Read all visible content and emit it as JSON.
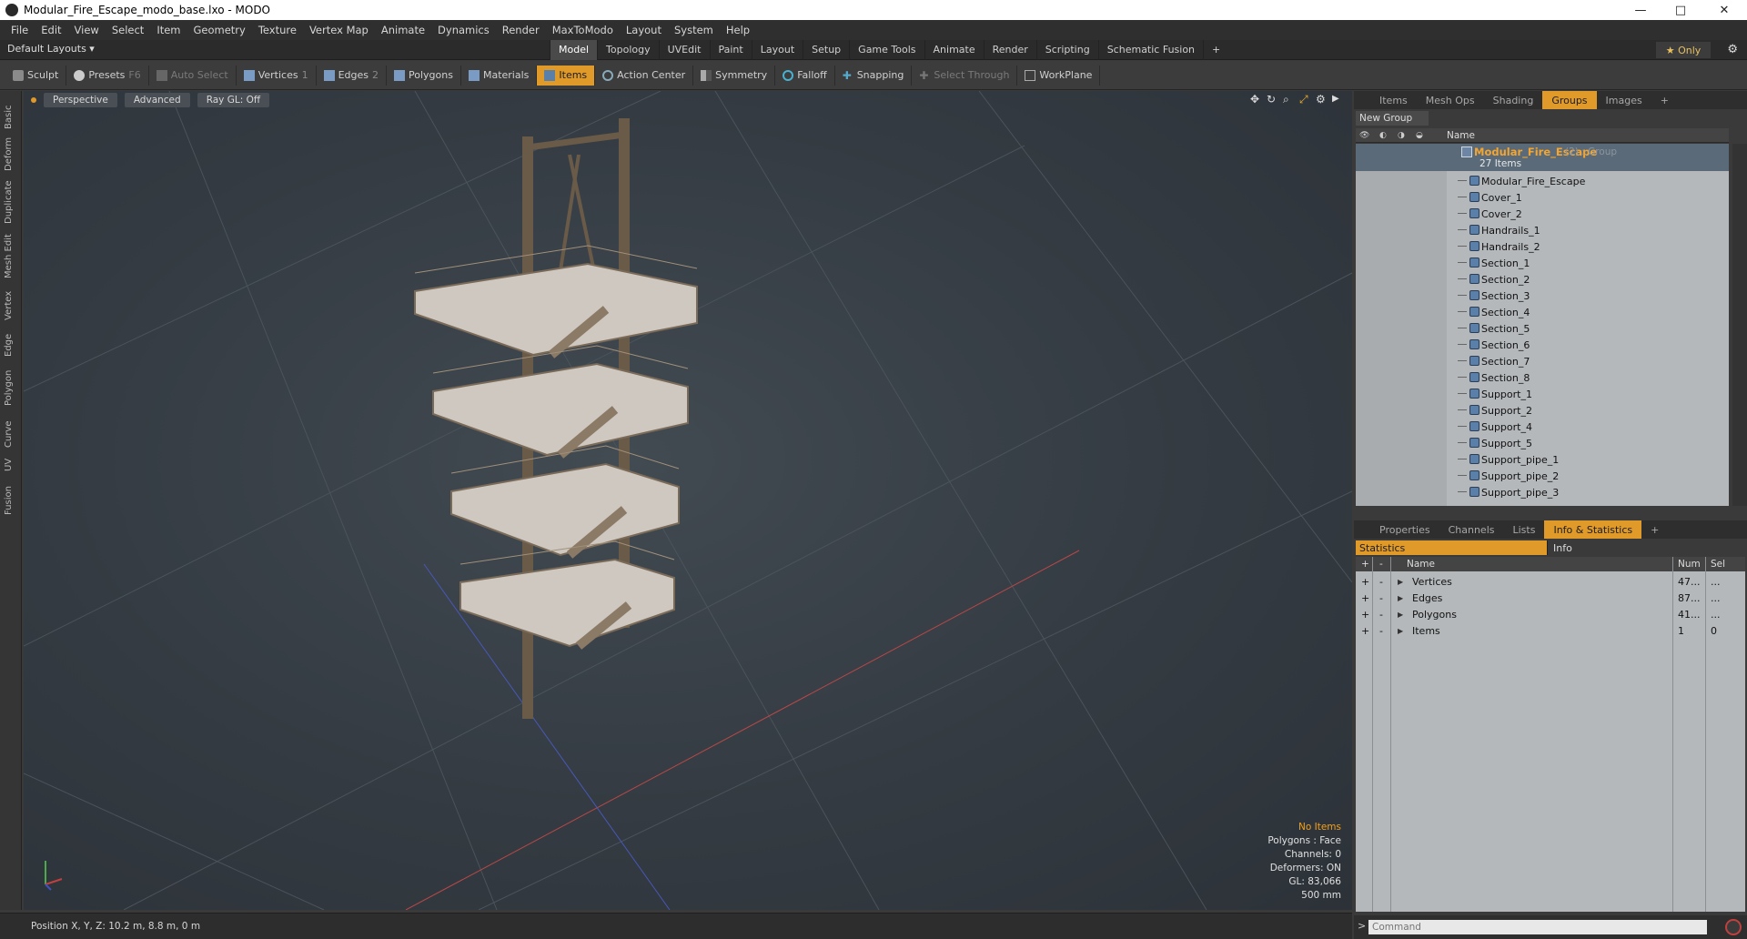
{
  "window": {
    "title": "Modular_Fire_Escape_modo_base.lxo - MODO",
    "minimize": "—",
    "maximize": "□",
    "close": "✕"
  },
  "menu": [
    "File",
    "Edit",
    "View",
    "Select",
    "Item",
    "Geometry",
    "Texture",
    "Vertex Map",
    "Animate",
    "Dynamics",
    "Render",
    "MaxToModo",
    "Layout",
    "System",
    "Help"
  ],
  "layout": {
    "name": "Default Layouts ▾",
    "tabs": [
      "Model",
      "Topology",
      "UVEdit",
      "Paint",
      "Layout",
      "Setup",
      "Game Tools",
      "Animate",
      "Render",
      "Scripting",
      "Schematic Fusion",
      "+"
    ],
    "active_tab": "Model",
    "only": "★ Only"
  },
  "toolbar": {
    "sculpt": "Sculpt",
    "presets": "Presets",
    "presets_key": "F6",
    "auto_select": "Auto Select",
    "vertices": "Vertices",
    "vertices_count": "1",
    "edges": "Edges",
    "edges_count": "2",
    "polygons": "Polygons",
    "materials": "Materials",
    "items": "Items",
    "action_center": "Action Center",
    "symmetry": "Symmetry",
    "falloff": "Falloff",
    "snapping": "Snapping",
    "select_through": "Select Through",
    "workplane": "WorkPlane"
  },
  "left_tabs": [
    "Basic",
    "Deform",
    "Duplicate",
    "Mesh Edit",
    "Vertex",
    "Edge",
    "Polygon",
    "Curve",
    "UV",
    "Fusion"
  ],
  "viewport": {
    "view": "Perspective",
    "shading": "Advanced",
    "raygl": "Ray GL: Off",
    "hud": {
      "no_items": "No Items",
      "polygons": "Polygons : Face",
      "channels": "Channels: 0",
      "deformers": "Deformers: ON",
      "gl": "GL: 83,066",
      "scale": "500 mm"
    }
  },
  "status": {
    "position": "Position X, Y, Z:   10.2 m, 8.8 m, 0 m"
  },
  "groups_panel": {
    "tabs": [
      "Items",
      "Mesh Ops",
      "Shading",
      "Groups",
      "Images",
      "+"
    ],
    "active_tab": "Groups",
    "new_group": "New Group",
    "col_name": "Name",
    "root": {
      "name": "Modular_Fire_Escape",
      "suffix": "(2) : Group",
      "count": "27 Items"
    },
    "items": [
      "Modular_Fire_Escape",
      "Cover_1",
      "Cover_2",
      "Handrails_1",
      "Handrails_2",
      "Section_1",
      "Section_2",
      "Section_3",
      "Section_4",
      "Section_5",
      "Section_6",
      "Section_7",
      "Section_8",
      "Support_1",
      "Support_2",
      "Support_4",
      "Support_5",
      "Support_pipe_1",
      "Support_pipe_2",
      "Support_pipe_3"
    ]
  },
  "props_panel": {
    "tabs": [
      "Properties",
      "Channels",
      "Lists",
      "Info & Statistics",
      "+"
    ],
    "active_tab": "Info & Statistics",
    "sub_statistics": "Statistics",
    "sub_info": "Info",
    "headers": {
      "plus": "+",
      "minus": "-",
      "name": "Name",
      "num": "Num",
      "sel": "Sel"
    },
    "rows": [
      {
        "name": "Vertices",
        "num": "47...",
        "sel": "..."
      },
      {
        "name": "Edges",
        "num": "87...",
        "sel": "..."
      },
      {
        "name": "Polygons",
        "num": "41...",
        "sel": "..."
      },
      {
        "name": "Items",
        "num": "1",
        "sel": "0"
      }
    ]
  },
  "command": {
    "prompt": ">",
    "placeholder": "Command"
  }
}
